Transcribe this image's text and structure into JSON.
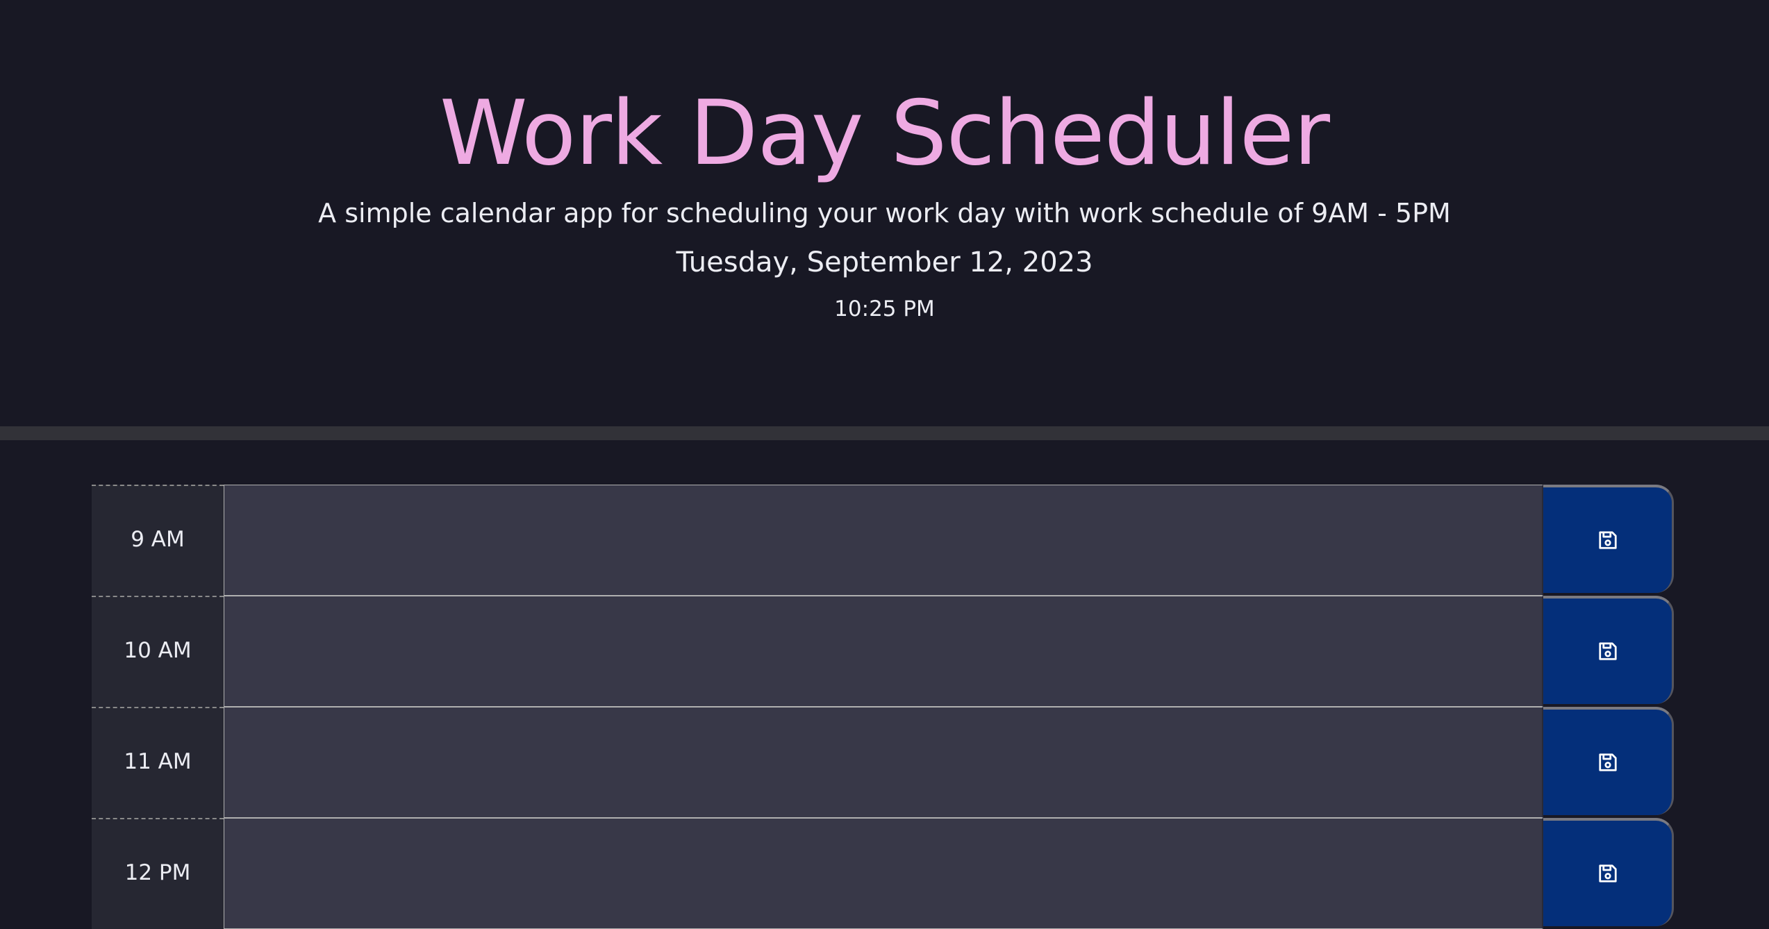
{
  "header": {
    "title": "Work Day Scheduler",
    "subtitle": "A simple calendar app for scheduling your work day with work schedule of 9AM - 5PM",
    "date": "Tuesday, September 12, 2023",
    "time": "10:25 PM"
  },
  "colors": {
    "background": "#181824",
    "title": "#eeaae2",
    "divider": "#323238",
    "hour_cell": "#262732",
    "textarea": "#383848",
    "save_button": "#042f7a"
  },
  "rows": [
    {
      "hour": "9 AM",
      "text": "",
      "save_icon": "floppy-disk-icon"
    },
    {
      "hour": "10 AM",
      "text": "",
      "save_icon": "floppy-disk-icon"
    },
    {
      "hour": "11 AM",
      "text": "",
      "save_icon": "floppy-disk-icon"
    },
    {
      "hour": "12 PM",
      "text": "",
      "save_icon": "floppy-disk-icon"
    }
  ]
}
